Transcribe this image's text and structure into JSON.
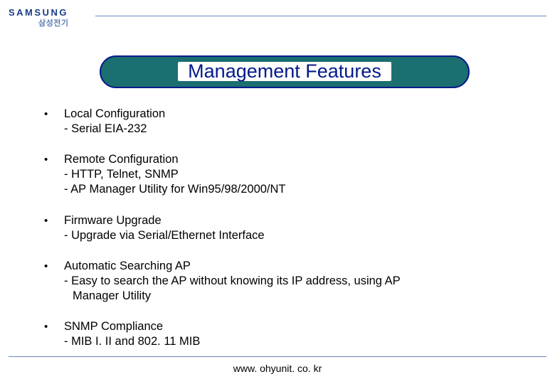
{
  "logo": {
    "main": "SAMSUNG",
    "sub": "삼성전기"
  },
  "title": "Management Features",
  "items": [
    {
      "title": "Local Configuration",
      "subs": [
        "Serial EIA-232"
      ]
    },
    {
      "title": "Remote Configuration",
      "subs": [
        "HTTP, Telnet, SNMP",
        "AP Manager Utility for Win95/98/2000/NT"
      ]
    },
    {
      "title": "Firmware Upgrade",
      "subs": [
        "Upgrade via Serial/Ethernet Interface"
      ]
    },
    {
      "title": "Automatic Searching AP",
      "subs": [
        "Easy to search the AP without knowing its IP address, using AP",
        "  Manager Utility"
      ]
    },
    {
      "title": "SNMP Compliance",
      "subs": [
        "MIB I. II and 802. 11 MIB"
      ]
    }
  ],
  "footer": "www. ohyunit. co. kr"
}
